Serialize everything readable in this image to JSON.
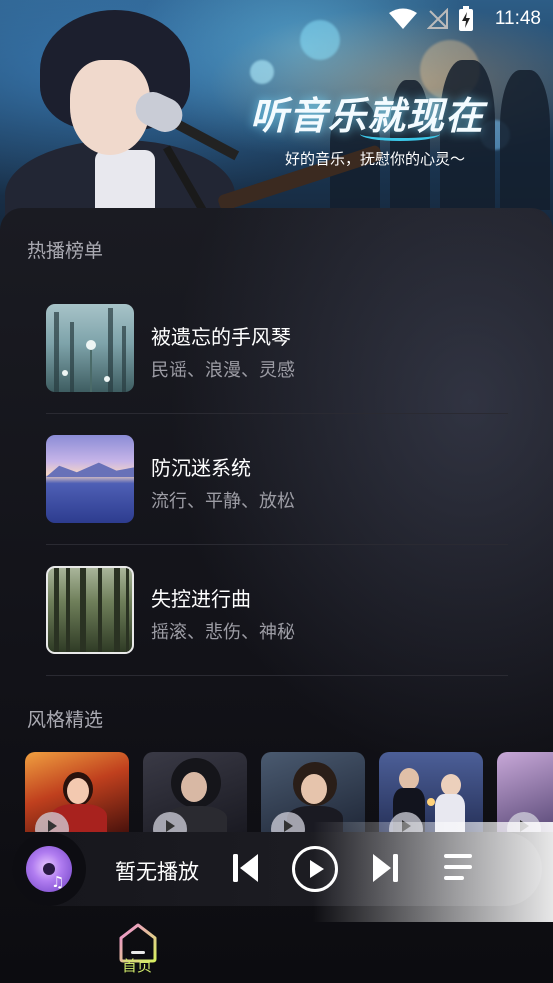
{
  "status_bar": {
    "time": "11:48"
  },
  "hero": {
    "title": "听音乐就现在",
    "subtitle": "好的音乐，抚慰你的心灵～"
  },
  "hot_chart": {
    "title": "热播榜单",
    "items": [
      {
        "title": "被遗忘的手风琴",
        "tags": "民谣、浪漫、灵感"
      },
      {
        "title": "防沉迷系统",
        "tags": "流行、平静、放松"
      },
      {
        "title": "失控进行曲",
        "tags": "摇滚、悲伤、神秘"
      }
    ]
  },
  "style_picks": {
    "title": "风格精选"
  },
  "mini_player": {
    "status": "暂无播放"
  },
  "bottom_nav": {
    "home_label": "首页"
  },
  "colors": {
    "accent": "#cfe86a",
    "background": "#0d0d12"
  }
}
